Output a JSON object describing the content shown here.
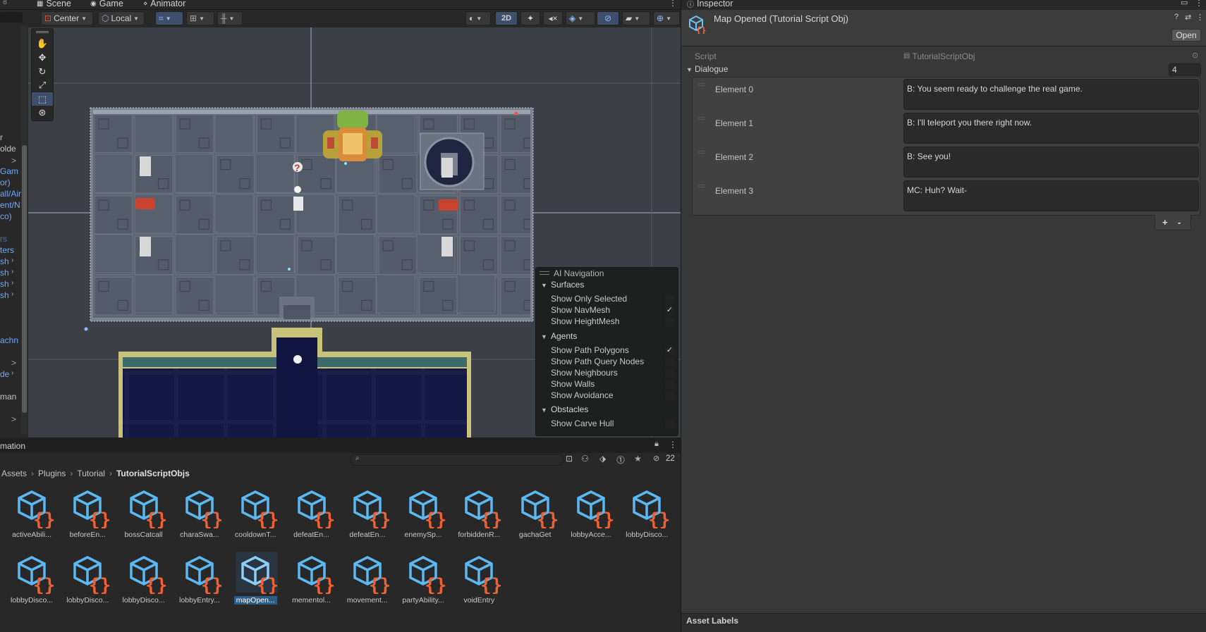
{
  "scene_tabs": [
    {
      "icon": "grid-icon",
      "label": "Scene"
    },
    {
      "icon": "gamepad-icon",
      "label": "Game"
    },
    {
      "icon": "animator-icon",
      "label": "Animator"
    }
  ],
  "scene_toolbar": {
    "pivot": "Center",
    "space": "Local",
    "mode_2d": "2D"
  },
  "hierarchy_fragments": [
    "r",
    "olde",
    ">",
    "Gam",
    "or)",
    "all/Air",
    "ent/N",
    "co)",
    "rs",
    "ters",
    "sh",
    "sh",
    "sh",
    "sh",
    "achn",
    ">",
    "de",
    "man",
    ">"
  ],
  "ai_navigation": {
    "title": "AI Navigation",
    "sections": [
      {
        "name": "Surfaces",
        "items": [
          {
            "label": "Show Only Selected",
            "checked": false
          },
          {
            "label": "Show NavMesh",
            "checked": true
          },
          {
            "label": "Show HeightMesh",
            "checked": false
          }
        ]
      },
      {
        "name": "Agents",
        "items": [
          {
            "label": "Show Path Polygons",
            "checked": true
          },
          {
            "label": "Show Path Query Nodes",
            "checked": false
          },
          {
            "label": "Show Neighbours",
            "checked": false
          },
          {
            "label": "Show Walls",
            "checked": false
          },
          {
            "label": "Show Avoidance",
            "checked": false
          }
        ]
      },
      {
        "name": "Obstacles",
        "items": [
          {
            "label": "Show Carve Hull",
            "checked": false
          }
        ]
      }
    ]
  },
  "project": {
    "panel_tab": "mation",
    "breadcrumb": [
      "Assets",
      "Plugins",
      "Tutorial",
      "TutorialScriptObjs"
    ],
    "hidden_count": "22",
    "assets": [
      "activeAbili...",
      "beforeEn...",
      "bossCatcall",
      "charaSwa...",
      "cooldownT...",
      "defeatEn...",
      "defeatEn...",
      "enemySp...",
      "forbiddenR...",
      "gachaGet",
      "lobbyAcce...",
      "lobbyDisco...",
      "lobbyDisco...",
      "lobbyDisco...",
      "lobbyDisco...",
      "lobbyEntry...",
      "mapOpen...",
      "mementol...",
      "movement...",
      "partyAbility...",
      "voidEntry"
    ],
    "selected_index": 16
  },
  "inspector": {
    "tab": "Inspector",
    "title": "Map Opened (Tutorial Script Obj)",
    "open_label": "Open",
    "script_label": "Script",
    "script_value": "TutorialScriptObj",
    "dialogue_label": "Dialogue",
    "dialogue_count": "4",
    "elements": [
      {
        "label": "Element 0",
        "text": "B: You seem ready to challenge the real game."
      },
      {
        "label": "Element 1",
        "text": "B: I'll teleport you there right now."
      },
      {
        "label": "Element 2",
        "text": "B: See you!"
      },
      {
        "label": "Element 3",
        "text": "MC: Huh? Wait-"
      }
    ],
    "add_label": "+",
    "remove_label": "-",
    "asset_labels": "Asset Labels"
  },
  "colors": {
    "accent": "#2c5d87",
    "panel": "#383838",
    "scene_bg": "#3c3f46",
    "tile": "#59606e"
  }
}
